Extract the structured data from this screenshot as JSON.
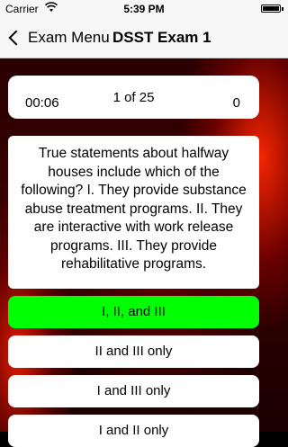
{
  "status_bar": {
    "carrier": "Carrier",
    "time": "5:39 PM",
    "wifi_icon": "wifi-icon",
    "battery_icon": "battery-icon"
  },
  "nav": {
    "back_label": "Exam Menu",
    "title": "DSST Exam 1"
  },
  "score_panel": {
    "timer": "00:06",
    "progress": "1 of 25",
    "score": "0"
  },
  "question": {
    "text": "True statements about halfway houses include which of the following? I. They provide substance abuse treatment programs. II. They are interactive with work release programs. III. They provide rehabilitative programs."
  },
  "answers": [
    {
      "label": "I, II, and III",
      "state": "correct"
    },
    {
      "label": "II and III only",
      "state": "normal"
    },
    {
      "label": "I and III only",
      "state": "normal"
    },
    {
      "label": "I and II only",
      "state": "normal"
    }
  ],
  "colors": {
    "correct": "#00ff00",
    "background_accent": "#cc0000"
  }
}
